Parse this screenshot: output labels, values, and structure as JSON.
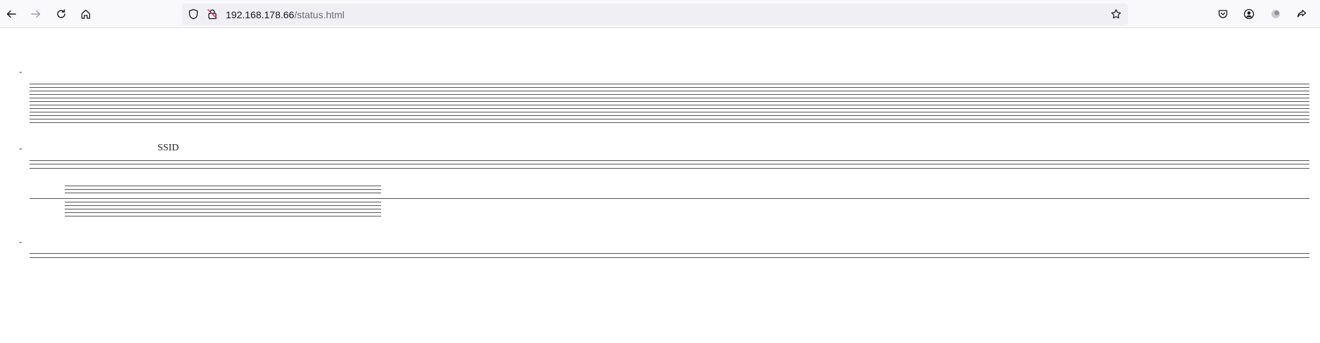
{
  "browser": {
    "url_host": "192.168.178.66",
    "url_path": "/status.html",
    "icons": {
      "back": "back-arrow-icon",
      "forward": "forward-arrow-icon",
      "reload": "reload-icon",
      "home": "home-icon",
      "shield": "shield-icon",
      "insecure_lock": "insecure-lock-icon",
      "bookmark": "bookmark-star-icon",
      "pocket": "pocket-icon",
      "account": "account-icon",
      "extension": "extension-icon",
      "share": "share-icon"
    }
  },
  "page": {
    "section_markers": [
      "-",
      "-",
      "-"
    ],
    "ssid_label": "SSID"
  }
}
